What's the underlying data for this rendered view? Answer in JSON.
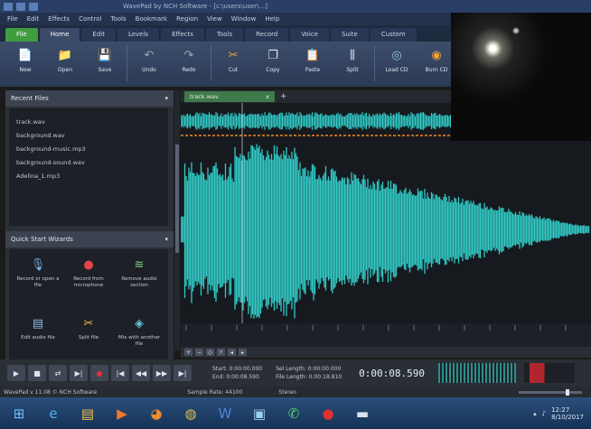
{
  "titlebar": {
    "title": "WavePad by NCH Software - [c:\\users\\user\\...]"
  },
  "menu": [
    "File",
    "Edit",
    "Effects",
    "Control",
    "Tools",
    "Bookmark",
    "Region",
    "View",
    "Window",
    "Help"
  ],
  "tabs": [
    {
      "label": "File"
    },
    {
      "label": "Home"
    },
    {
      "label": "Edit"
    },
    {
      "label": "Levels"
    },
    {
      "label": "Effects"
    },
    {
      "label": "Tools"
    },
    {
      "label": "Record"
    },
    {
      "label": "Voice"
    },
    {
      "label": "Suite"
    },
    {
      "label": "Custom"
    }
  ],
  "ribbon": [
    {
      "label": "New",
      "icon": "new-file-icon"
    },
    {
      "label": "Open",
      "icon": "open-folder-icon"
    },
    {
      "label": "Save",
      "icon": "save-disk-icon"
    },
    {
      "label": "Undo",
      "icon": "undo-icon"
    },
    {
      "label": "Redo",
      "icon": "redo-icon"
    },
    {
      "label": "Cut",
      "icon": "scissors-icon"
    },
    {
      "label": "Copy",
      "icon": "copy-icon"
    },
    {
      "label": "Paste",
      "icon": "paste-icon"
    },
    {
      "label": "Split",
      "icon": "split-icon"
    },
    {
      "label": "Load CD",
      "icon": "cd-icon"
    },
    {
      "label": "Burn CD",
      "icon": "burn-cd-icon"
    }
  ],
  "left_panel": {
    "recent_title": "Recent Files",
    "recent_files": [
      "track.wav",
      "background.wav",
      "background-music.mp3",
      "background-sound.wav",
      "Adelina_1.mp3"
    ],
    "quick_start_title": "Quick Start Wizards",
    "quick_start": [
      {
        "label": "Record or open a file",
        "icon": "microphone-icon"
      },
      {
        "label": "Record from microphone",
        "icon": "record-icon"
      },
      {
        "label": "Remove audio section",
        "icon": "waveform-icon"
      },
      {
        "label": "Edit audio file",
        "icon": "edit-audio-icon"
      },
      {
        "label": "Split file",
        "icon": "scissors-icon"
      },
      {
        "label": "Mix with another file",
        "icon": "mix-icon"
      }
    ]
  },
  "file_tab": {
    "label": "track.wav",
    "close": "x",
    "add": "+"
  },
  "transport": {
    "buttons": [
      "play",
      "stop",
      "loop",
      "play-to-end",
      "record",
      "rewind",
      "back",
      "forward",
      "end"
    ],
    "start_label": "Start: 0:00:00.000",
    "end_label": "End: 0:00:08.590",
    "sel_label": "Sel Length: 0:00:00.000",
    "file_label": "File Length: 0:00:18.810",
    "clock": "0:00:08.590"
  },
  "status": {
    "left": "WavePad v 11.08 © NCH Software",
    "center": "Sample Rate: 44100",
    "right": "Stereo"
  },
  "taskbar": {
    "apps": [
      "windows-orb-icon",
      "ie-icon",
      "explorer-icon",
      "media-icon",
      "firefox-icon",
      "chrome-icon",
      "word-icon",
      "app-icon",
      "whatsapp-icon",
      "record-app-icon",
      "wavepad-icon"
    ],
    "time": "12:27",
    "date": "8/10/2017"
  },
  "colors": {
    "wave": "#31c9c5",
    "accent": "#3f9c3f",
    "rec": "#e0323a"
  }
}
